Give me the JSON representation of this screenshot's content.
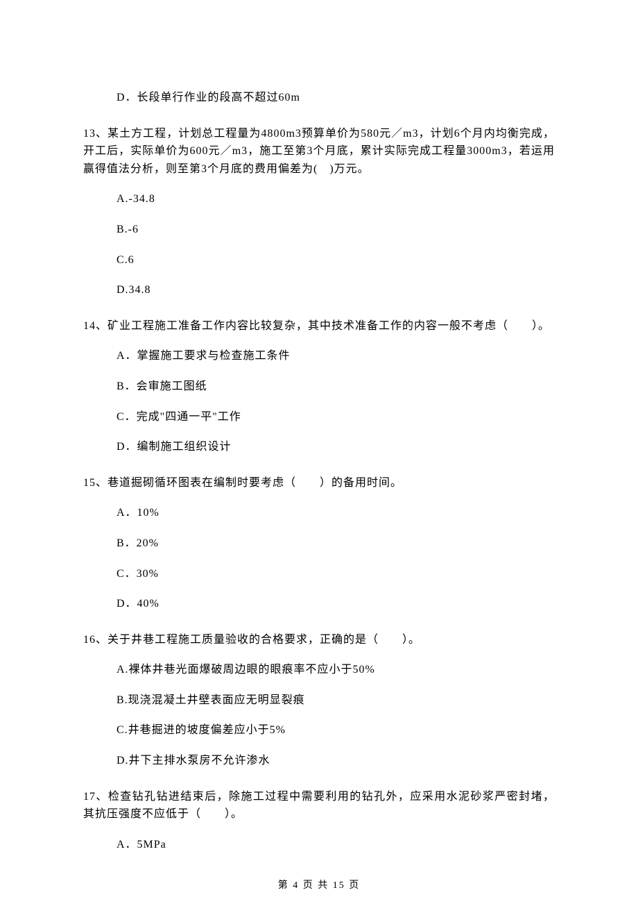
{
  "q12": {
    "optD": "D．长段单行作业的段高不超过60m"
  },
  "q13": {
    "stem": "13、某土方工程，计划总工程量为4800m3预算单价为580元／m3，计划6个月内均衡完成，开工后，实际单价为600元／m3，施工至第3个月底，累计实际完成工程量3000m3，若运用赢得值法分析，则至第3个月底的费用偏差为(　)万元。",
    "optA": "A.-34.8",
    "optB": "B.-6",
    "optC": "C.6",
    "optD": "D.34.8"
  },
  "q14": {
    "stem": "14、矿业工程施工准备工作内容比较复杂，其中技术准备工作的内容一般不考虑（　　）。",
    "optA": "A．掌握施工要求与检查施工条件",
    "optB": "B．会审施工图纸",
    "optC": "C．完成\"四通一平\"工作",
    "optD": "D．编制施工组织设计"
  },
  "q15": {
    "stem": "15、巷道掘砌循环图表在编制时要考虑（　　）的备用时间。",
    "optA": "A．10%",
    "optB": "B．20%",
    "optC": "C．30%",
    "optD": "D．40%"
  },
  "q16": {
    "stem": "16、关于井巷工程施工质量验收的合格要求，正确的是（　　）。",
    "optA": "A.裸体井巷光面爆破周边眼的眼痕率不应小于50%",
    "optB": "B.现浇混凝土井壁表面应无明显裂痕",
    "optC": "C.井巷掘进的坡度偏差应小于5%",
    "optD": "D.井下主排水泵房不允许渗水"
  },
  "q17": {
    "stem": "17、检查钻孔钻进结束后，除施工过程中需要利用的钻孔外，应采用水泥砂浆严密封堵，其抗压强度不应低于（　　）。",
    "optA": "A．5MPa"
  },
  "footer": "第 4 页 共 15 页"
}
